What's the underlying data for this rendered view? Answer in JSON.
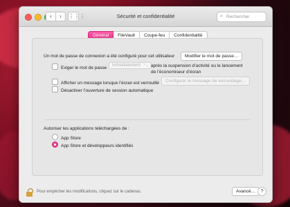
{
  "window": {
    "title": "Sécurité et confidentialité"
  },
  "toolbar": {
    "back": "‹",
    "forward": "›",
    "grid": "⋮⋮⋮",
    "search_placeholder": "Rechercher"
  },
  "tabs": [
    {
      "label": "Général",
      "active": true
    },
    {
      "label": "FileVault",
      "active": false
    },
    {
      "label": "Coupe-feu",
      "active": false
    },
    {
      "label": "Confidentialité",
      "active": false
    }
  ],
  "general": {
    "password_text": "Un mot de passe de connexion a été configuré pour cet utilisateur",
    "change_password_button": "Modifier le mot de passe…",
    "require_password_label": "Exiger le mot de passe",
    "require_password_value": "immédiatement",
    "require_password_suffix_1": "après la suspension d’activité ou le lancement",
    "require_password_suffix_2": "de l’économiseur d’écran",
    "show_message_label": "Afficher un message lorsque l’écran est verrouillé",
    "configure_message_button": "Configurer le message de verrouillage…",
    "disable_autologin_label": "Désactiver l’ouverture de session automatique"
  },
  "apps": {
    "heading": "Autoriser les applications téléchargées de :",
    "option_app_store": "App Store",
    "option_identified": "App Store et développeurs identifiés",
    "selected": "option_identified"
  },
  "footer": {
    "lock_message": "Pour empêcher les modifications, cliquez sur le cadenas.",
    "advanced_button": "Avancé…",
    "help": "?"
  },
  "colors": {
    "accent": "#e8438e"
  }
}
